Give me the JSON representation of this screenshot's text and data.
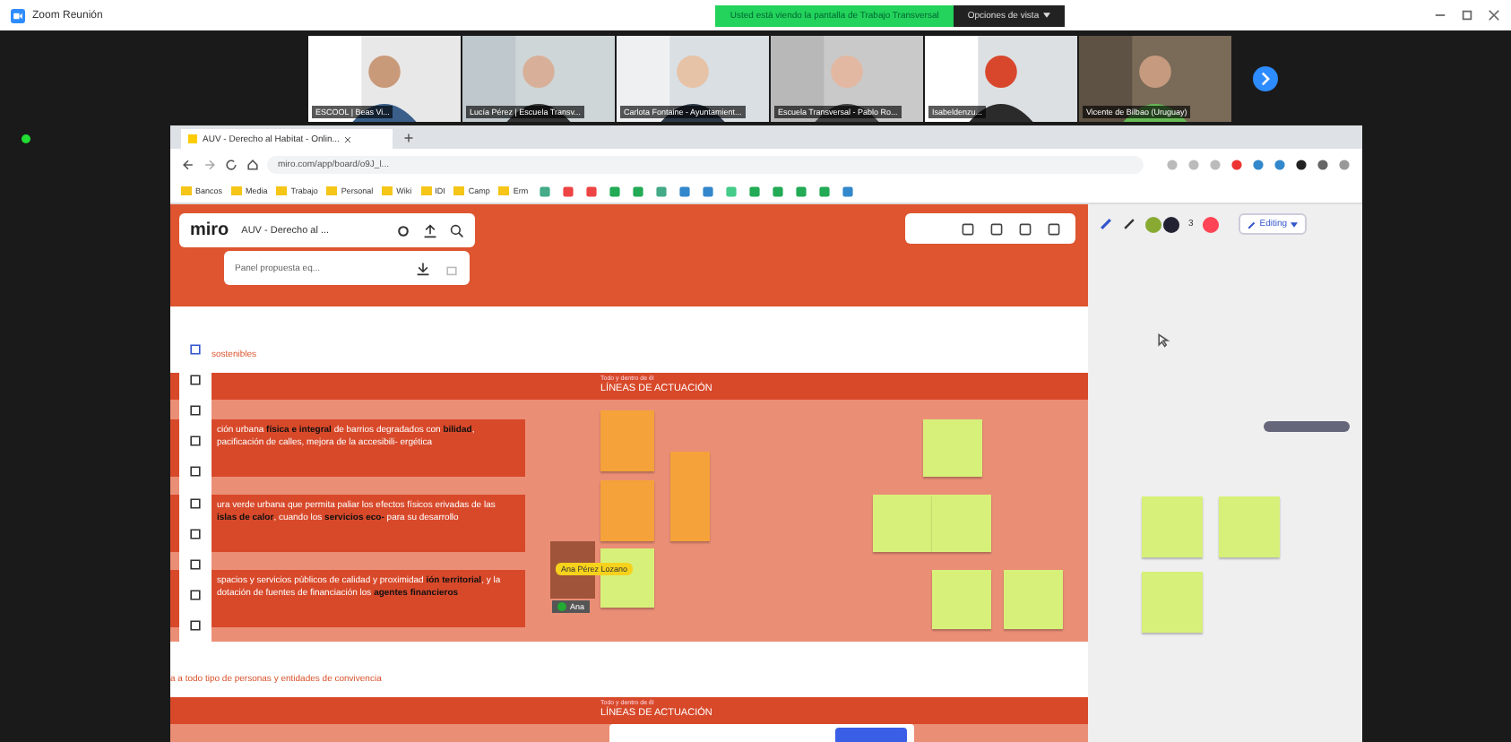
{
  "meeting": {
    "app_title": "Zoom Reunión",
    "sharing_banner": "Usted está viendo la pantalla de Trabajo Transversal",
    "view_options": "Opciones de vista"
  },
  "participants": [
    {
      "name": "ESCOOL | Beas Vi..."
    },
    {
      "name": "Lucía Pérez | Escuela Transv..."
    },
    {
      "name": "Carlota Fontaine - Ayuntamient..."
    },
    {
      "name": "Escuela Transversal - Pablo Ro..."
    },
    {
      "name": "Isabeldenzu..."
    },
    {
      "name": "Vicente de Bilbao (Uruguay)"
    }
  ],
  "browser": {
    "tab_title": "AUV - Derecho al Habitat - Onlin...",
    "url": "miro.com/app/board/o9J_l...",
    "bookmarks": [
      "Bancos",
      "Media",
      "Trabajo",
      "Personal",
      "Wiki",
      "IDI",
      "Camp",
      "Erm"
    ]
  },
  "miro": {
    "logo": "miro",
    "board_name": "AUV - Derecho al ...",
    "frame_name": "Panel propuesta eq...",
    "mode": "Editing",
    "collaborator_count": "3"
  },
  "canvas": {
    "section_1": {
      "label": "sostenibles",
      "kicker": "Todo y dentro de él",
      "header": "LÍNEAS DE ACTUACIÓN",
      "blocks": [
        "ción urbana **física e integral** de barrios degradados con **bilidad**, pacificación de calles, mejora de la accesibili- ergética",
        "ura verde urbana que permita paliar los efectos físicos erivadas de las **islas de calor**, cuando los **servicios eco-** para su desarrollo",
        "spacios y servicios públicos de calidad y proximidad **ión territorial**, y la dotación de fuentes de financiación los **agentes financieros**"
      ]
    },
    "cursor_label": "Ana Pérez Lozano",
    "avatar_label": "Ana",
    "section_2": {
      "label": "a a todo tipo de personas y entidades de convivencia",
      "kicker": "Todo y dentro de él",
      "header": "LÍNEAS DE ACTUACIÓN"
    }
  }
}
